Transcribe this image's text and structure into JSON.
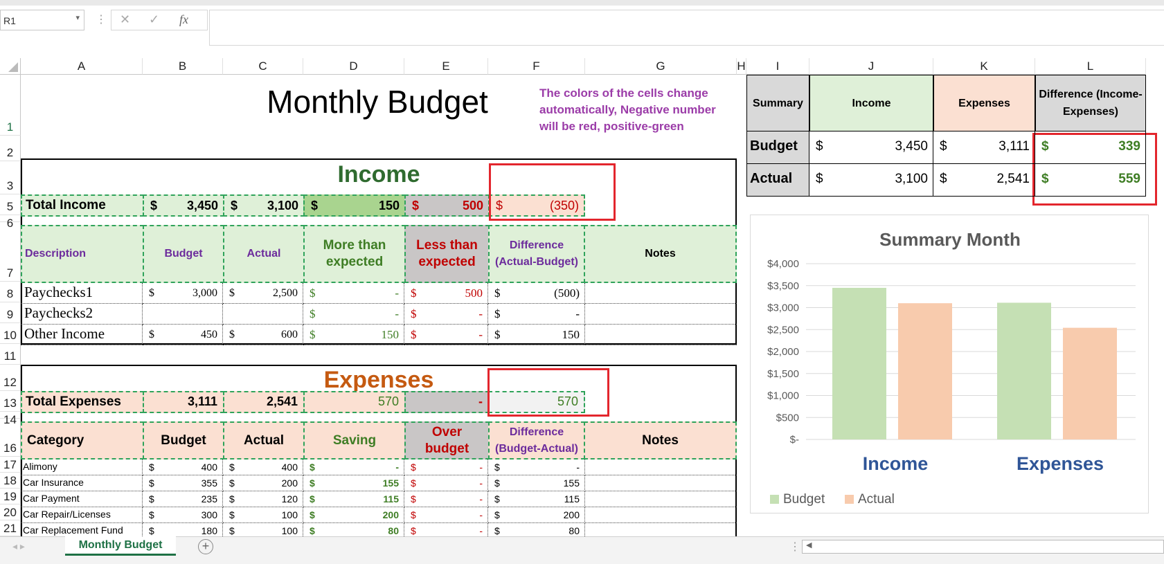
{
  "namebox": "R1",
  "fx": "fx",
  "columns": [
    "A",
    "B",
    "C",
    "D",
    "E",
    "F",
    "G",
    "H",
    "I",
    "J",
    "K",
    "L"
  ],
  "rows": [
    "1",
    "2",
    "3",
    "5",
    "6",
    "7",
    "8",
    "9",
    "10",
    "11",
    "12",
    "13",
    "14",
    "16",
    "17",
    "18",
    "19",
    "20",
    "21"
  ],
  "title": "Monthly Budget",
  "note": "The colors of the cells change automatically, Negative number will be red, positive-green",
  "income": {
    "heading": "Income",
    "total_label": "Total Income",
    "total_budget": "3,450",
    "total_actual": "3,100",
    "total_more": "150",
    "total_less": "500",
    "total_diff": "(350)",
    "headers": [
      "Description",
      "Budget",
      "Actual",
      "More than expected",
      "Less than expected",
      "Difference (Actual-Budget)",
      "Notes"
    ],
    "rows": [
      {
        "desc": "Paychecks1",
        "budget": "3,000",
        "actual": "2,500",
        "more": "-",
        "less": "500",
        "diff": "(500)"
      },
      {
        "desc": "Paychecks2",
        "budget": "",
        "actual": "",
        "more": "-",
        "less": "-",
        "diff": "-"
      },
      {
        "desc": "Other Income",
        "budget": "450",
        "actual": "600",
        "more": "150",
        "less": "-",
        "diff": "150"
      }
    ]
  },
  "expenses": {
    "heading": "Expenses",
    "total_label": "Total Expenses",
    "total_budget": "3,111",
    "total_actual": "2,541",
    "total_saving": "570",
    "total_over": "-",
    "total_diff": "570",
    "headers": [
      "Category",
      "Budget",
      "Actual",
      "Saving",
      "Over budget",
      "Difference (Budget-Actual)",
      "Notes"
    ],
    "rows": [
      {
        "cat": "Alimony",
        "budget": "400",
        "actual": "400",
        "saving": "-",
        "over": "-",
        "diff": "-"
      },
      {
        "cat": "Car Insurance",
        "budget": "355",
        "actual": "200",
        "saving": "155",
        "over": "-",
        "diff": "155"
      },
      {
        "cat": "Car Payment",
        "budget": "235",
        "actual": "120",
        "saving": "115",
        "over": "-",
        "diff": "115"
      },
      {
        "cat": "Car Repair/Licenses",
        "budget": "300",
        "actual": "100",
        "saving": "200",
        "over": "-",
        "diff": "200"
      },
      {
        "cat": "Car Replacement Fund",
        "budget": "180",
        "actual": "100",
        "saving": "80",
        "over": "-",
        "diff": "80"
      }
    ]
  },
  "summary": {
    "headers": [
      "Summary",
      "Income",
      "Expenses",
      "Difference (Income-Expenses)"
    ],
    "rows": [
      {
        "label": "Budget",
        "income": "3,450",
        "expenses": "3,111",
        "diff": "339"
      },
      {
        "label": "Actual",
        "income": "3,100",
        "expenses": "2,541",
        "diff": "559"
      }
    ]
  },
  "currency": "$",
  "chart_data": {
    "type": "bar",
    "title": "Summary Month",
    "categories": [
      "Income",
      "Expenses"
    ],
    "series": [
      {
        "name": "Budget",
        "values": [
          3450,
          3111
        ],
        "color": "#c5e0b4"
      },
      {
        "name": "Actual",
        "values": [
          3100,
          2541
        ],
        "color": "#f8cbad"
      }
    ],
    "ylim": [
      0,
      4000
    ],
    "yticks": [
      "$-",
      "$500",
      "$1,000",
      "$1,500",
      "$2,000",
      "$2,500",
      "$3,000",
      "$3,500",
      "$4,000"
    ],
    "legend": "bottom-left",
    "grid": true
  },
  "sheet_tab": "Monthly Budget",
  "colors": {
    "accent": "#1e7145",
    "income_heading": "#2f6b2f",
    "expenses_heading": "#c55a11",
    "highlight": "#e3262d"
  }
}
